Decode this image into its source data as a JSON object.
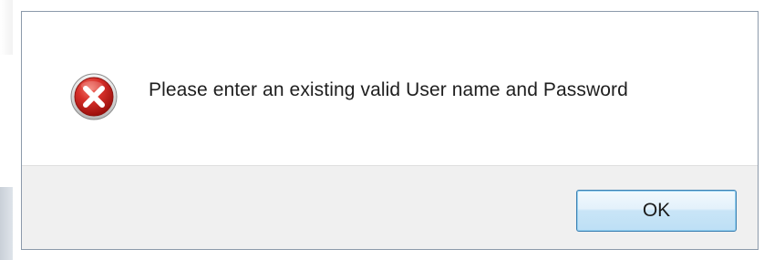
{
  "dialog": {
    "icon": "error-icon",
    "message": "Please enter an existing valid User name and Password",
    "ok_label": "OK"
  },
  "colors": {
    "error_red": "#c9221c",
    "button_border": "#3c7fb1",
    "button_fill": "#bddff6",
    "footer_bg": "#f0f0f0"
  }
}
